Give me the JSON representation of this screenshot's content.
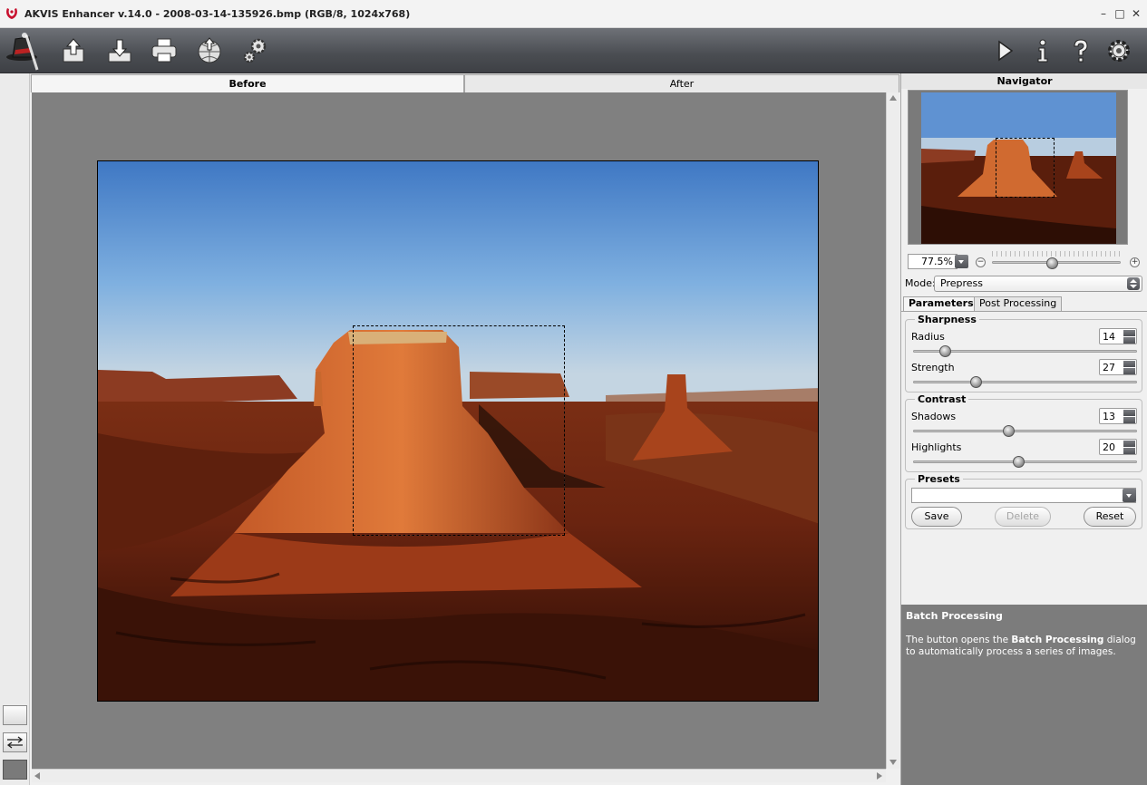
{
  "window": {
    "title": "AKVIS Enhancer v.14.0 - 2008-03-14-135926.bmp (RGB/8, 1024x768)",
    "controls": [
      "–",
      "□",
      "✕"
    ]
  },
  "toolbar": {
    "left_icons": [
      "magic-hat-icon",
      "open-image-icon",
      "save-image-icon",
      "print-icon",
      "publish-icon",
      "batch-processing-icon"
    ],
    "right_icons": [
      "run-icon",
      "info-icon",
      "help-icon",
      "settings-icon"
    ]
  },
  "tabs": {
    "before": "Before",
    "after": "After",
    "active": "Before"
  },
  "navigator": {
    "title": "Navigator",
    "zoom": "77.5%"
  },
  "mode": {
    "label": "Mode:",
    "value": "Prepress"
  },
  "panel_tabs": {
    "parameters": "Parameters",
    "post_processing": "Post Processing",
    "active": "Parameters"
  },
  "sharpness": {
    "title": "Sharpness",
    "radius_label": "Radius",
    "radius_value": "14",
    "strength_label": "Strength",
    "strength_value": "27"
  },
  "contrast": {
    "title": "Contrast",
    "shadows_label": "Shadows",
    "shadows_value": "13",
    "highlights_label": "Highlights",
    "highlights_value": "20"
  },
  "presets": {
    "title": "Presets",
    "value": "",
    "save": "Save",
    "delete": "Delete",
    "reset": "Reset"
  },
  "help": {
    "title": "Batch Processing",
    "text_before": "The button opens the ",
    "text_bold": "Batch Processing",
    "text_after": " dialog to automatically process a series of images."
  }
}
